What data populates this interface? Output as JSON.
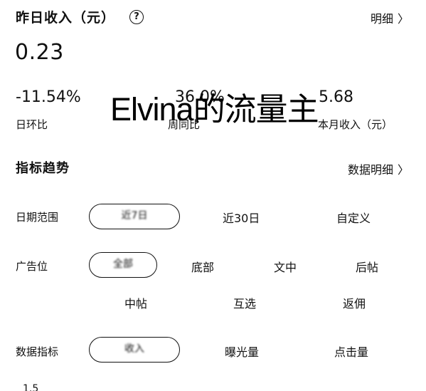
{
  "header": {
    "title": "昨日收入（元）",
    "help_icon": "?",
    "detail_link": "明细",
    "chevron": "〉"
  },
  "income": {
    "value": "0.23"
  },
  "stats": [
    {
      "value": "-11.54%",
      "label": "日环比"
    },
    {
      "value": "36.0%",
      "label": "周同比"
    },
    {
      "value": "5.68",
      "label": "本月收入（元）"
    }
  ],
  "watermark": "Elvina的流量主",
  "trend": {
    "title": "指标趋势",
    "detail_link": "数据明细"
  },
  "filters": {
    "date_range": {
      "label": "日期范围",
      "selected": "近7日",
      "options": [
        "近30日",
        "自定义"
      ]
    },
    "ad_position": {
      "label": "广告位",
      "selected": "全部",
      "options_row1": [
        "底部",
        "文中",
        "后帖"
      ],
      "options_row2": [
        "中帖",
        "互选",
        "返佣"
      ]
    },
    "metric": {
      "label": "数据指标",
      "selected": "收入",
      "options": [
        "曝光量",
        "点击量"
      ]
    }
  },
  "chart_axis_first_tick": "1.5",
  "colors": {
    "text": "#111111",
    "background": "#ffffff"
  }
}
